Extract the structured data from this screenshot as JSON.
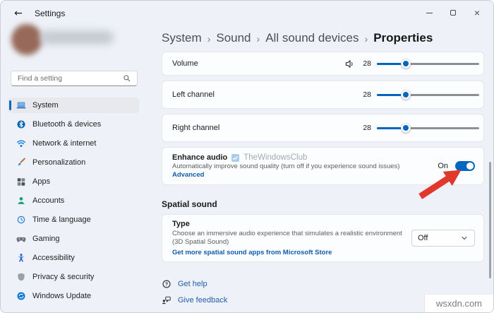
{
  "titlebar": {
    "title": "Settings"
  },
  "sidebar": {
    "search_placeholder": "Find a setting",
    "items": [
      {
        "label": "System",
        "selected": true
      },
      {
        "label": "Bluetooth & devices"
      },
      {
        "label": "Network & internet"
      },
      {
        "label": "Personalization"
      },
      {
        "label": "Apps"
      },
      {
        "label": "Accounts"
      },
      {
        "label": "Time & language"
      },
      {
        "label": "Gaming"
      },
      {
        "label": "Accessibility"
      },
      {
        "label": "Privacy & security"
      },
      {
        "label": "Windows Update"
      }
    ]
  },
  "breadcrumb": {
    "separator": "›",
    "items": [
      "System",
      "Sound",
      "All sound devices"
    ],
    "current": "Properties"
  },
  "sound": {
    "rows": [
      {
        "label": "Volume",
        "value": "28",
        "percent": 28
      },
      {
        "label": "Left channel",
        "value": "28",
        "percent": 28
      },
      {
        "label": "Right channel",
        "value": "28",
        "percent": 28
      }
    ]
  },
  "enhance_audio": {
    "title": "Enhance audio",
    "watermark_text": "TheWindowsClub",
    "description": "Automatically improve sound quality (turn off if you experience sound issues)",
    "advanced_link": "Advanced",
    "toggle_label": "On",
    "toggle_state": "on"
  },
  "spatial_sound": {
    "section_header": "Spatial sound",
    "row_title": "Type",
    "row_description": "Choose an immersive audio experience that simulates a realistic environment (3D Spatial Sound)",
    "store_link": "Get more spatial sound apps from Microsoft Store",
    "dropdown_value": "Off"
  },
  "footer_links": {
    "get_help": "Get help",
    "give_feedback": "Give feedback"
  },
  "overlay": {
    "site_watermark": "wsxdn.com"
  },
  "colors": {
    "accent": "#0067c0",
    "link": "#0f5cab",
    "footer_link": "#215db0",
    "arrow_red": "#e0382c"
  }
}
